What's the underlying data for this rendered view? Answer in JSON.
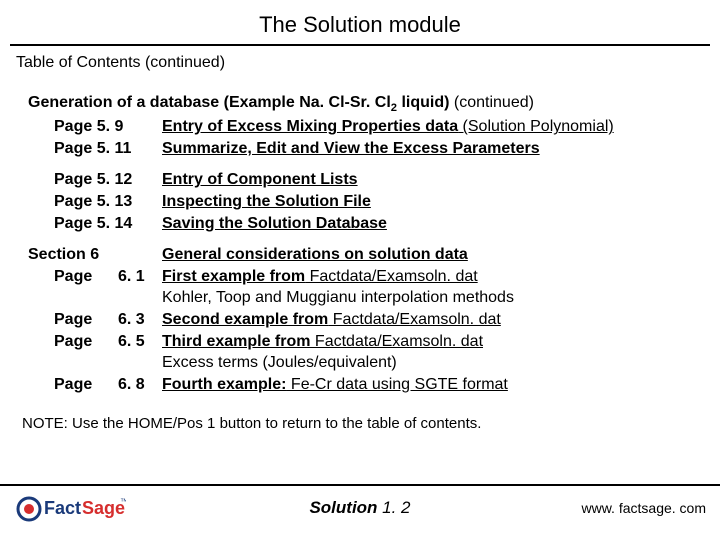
{
  "header": {
    "pre": "The ",
    "bold": "Solution",
    "post": " module"
  },
  "toc": {
    "title": "Table of Contents",
    "suffix": " (continued)"
  },
  "gen": {
    "lead_a": "Generation of a database (Example Na. Cl-Sr. Cl",
    "lead_sub": "2",
    "lead_b": " liquid)",
    "lead_suffix": " (continued)",
    "r1": {
      "c1": "Page  5. 9",
      "c2a": "Entry of Excess Mixing Properties data",
      "c2b": " (Solution Polynomial)"
    },
    "r2": {
      "c1": "Page  5. 11",
      "c2": "Summarize, Edit and View the Excess Parameters"
    },
    "r3": {
      "c1": "Page  5. 12",
      "c2": "Entry of Component Lists"
    },
    "r4": {
      "c1": "Page  5. 13",
      "c2": "Inspecting the Solution File"
    },
    "r5": {
      "c1": "Page  5. 14",
      "c2": "Saving the Solution Database"
    }
  },
  "sec6": {
    "s": "Section  6",
    "stitle": "General considerations on solution data",
    "r1": {
      "a": "Page",
      "b": "6. 1",
      "c_b": "First example from",
      "c_u": " Factdata/Examsoln. dat"
    },
    "r1x": "Kohler, Toop and Muggianu interpolation methods",
    "r2": {
      "a": "Page",
      "b": "6. 3",
      "c_b": "Second example from",
      "c_u": " Factdata/Examsoln. dat"
    },
    "r3": {
      "a": "Page",
      "b": "6. 5",
      "c_b": "Third example from",
      "c_u": " Factdata/Examsoln. dat"
    },
    "r3x": "Excess terms (Joules/equivalent)",
    "r4": {
      "a": "Page",
      "b": "6. 8",
      "c_b": "Fourth example:",
      "c_u": " Fe-Cr data using SGTE format"
    }
  },
  "note": {
    "pre": "NOTE: ",
    "body": "Use the HOME/Pos 1 button to return to the table of contents."
  },
  "footer": {
    "center_pre": "Solution",
    "center_num": " 1. 2",
    "right": "www. factsage. com",
    "logo": {
      "fact": "Fact",
      "sage": "Sage",
      "tm": "™"
    }
  }
}
